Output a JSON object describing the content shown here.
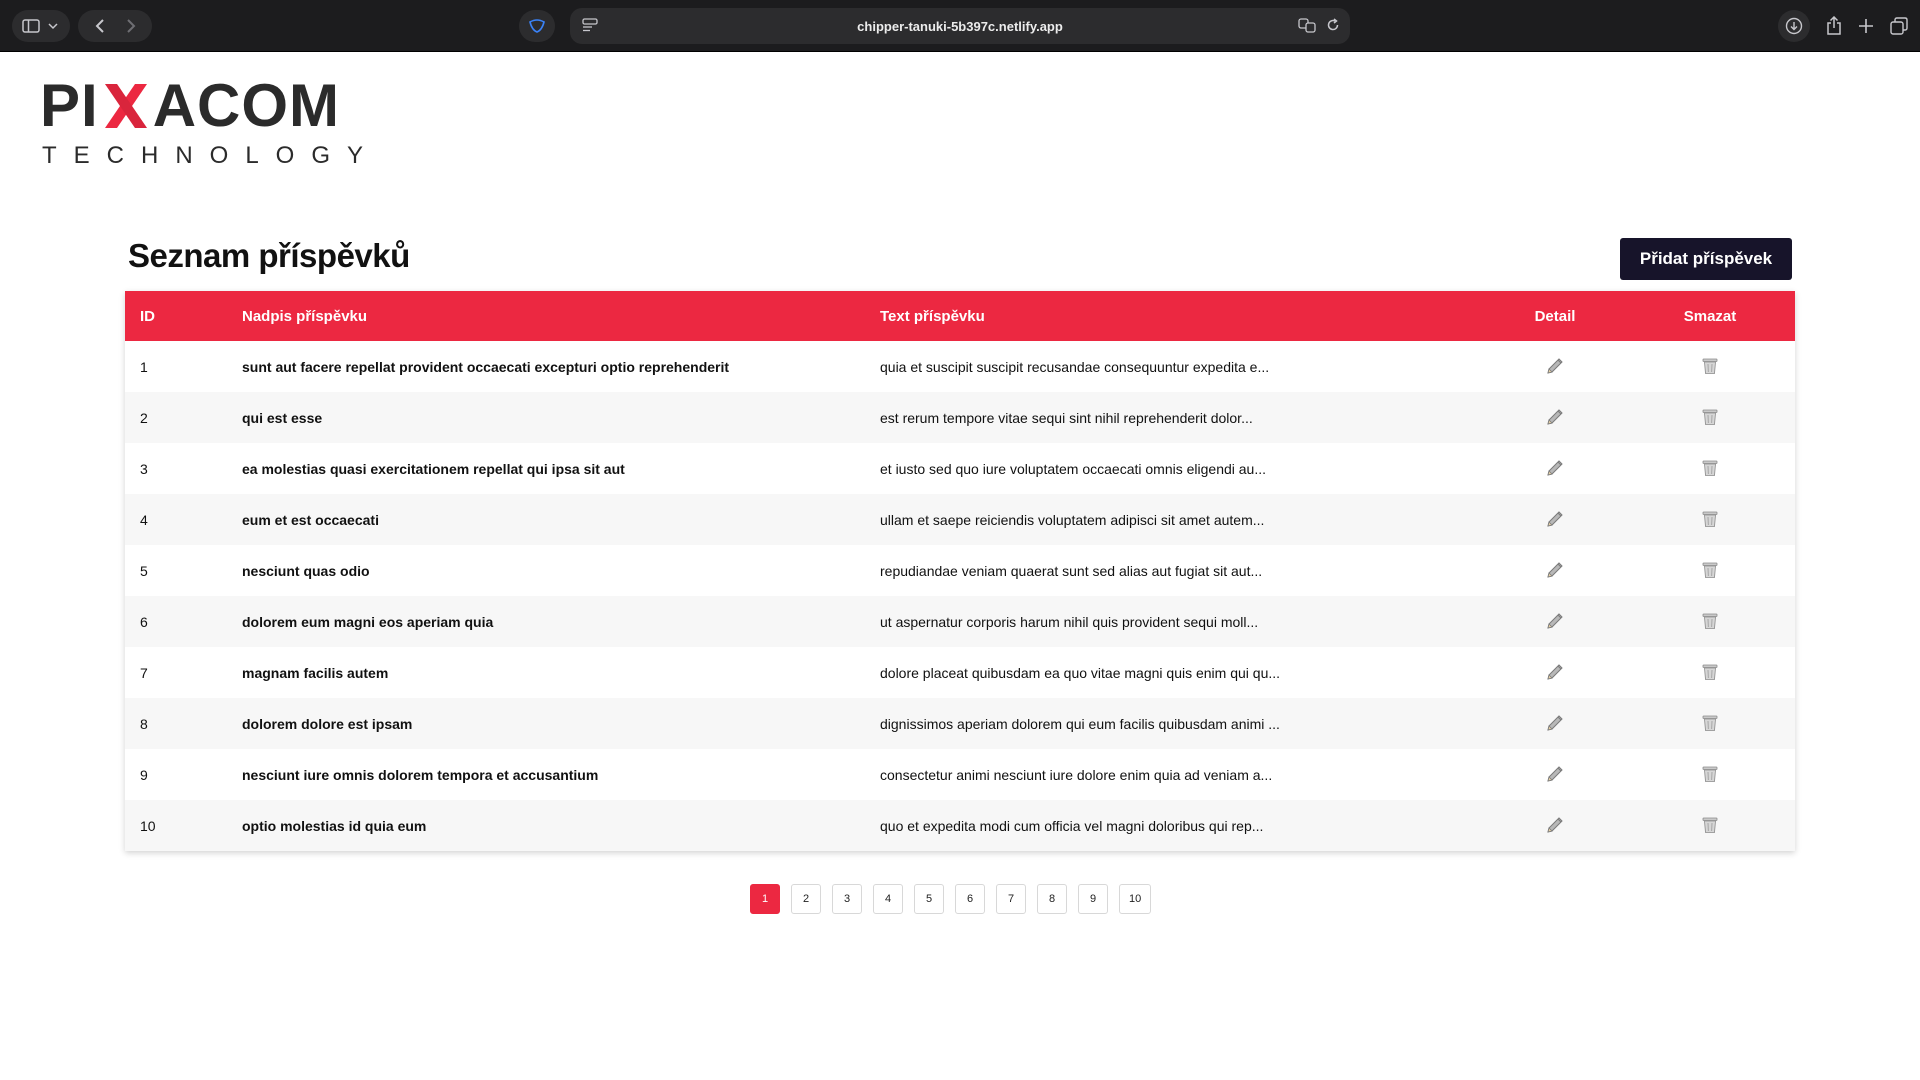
{
  "browser": {
    "url": "chipper-tanuki-5b397c.netlify.app"
  },
  "logo": {
    "brand_left": "PI",
    "brand_right": "ACOM",
    "subtitle": "TECHNOLOGY",
    "accent_color": "#ec2841"
  },
  "page": {
    "title": "Seznam příspěvků",
    "add_button": "Přidat příspěvek"
  },
  "table": {
    "headers": {
      "id": "ID",
      "title": "Nadpis příspěvku",
      "text": "Text příspěvku",
      "detail": "Detail",
      "delete": "Smazat"
    },
    "rows": [
      {
        "id": "1",
        "title": "sunt aut facere repellat provident occaecati excepturi optio reprehenderit",
        "text": "quia et suscipit suscipit recusandae consequuntur expedita e..."
      },
      {
        "id": "2",
        "title": "qui est esse",
        "text": "est rerum tempore vitae sequi sint nihil reprehenderit dolor..."
      },
      {
        "id": "3",
        "title": "ea molestias quasi exercitationem repellat qui ipsa sit aut",
        "text": "et iusto sed quo iure voluptatem occaecati omnis eligendi au..."
      },
      {
        "id": "4",
        "title": "eum et est occaecati",
        "text": "ullam et saepe reiciendis voluptatem adipisci sit amet autem..."
      },
      {
        "id": "5",
        "title": "nesciunt quas odio",
        "text": "repudiandae veniam quaerat sunt sed alias aut fugiat sit aut..."
      },
      {
        "id": "6",
        "title": "dolorem eum magni eos aperiam quia",
        "text": "ut aspernatur corporis harum nihil quis provident sequi moll..."
      },
      {
        "id": "7",
        "title": "magnam facilis autem",
        "text": "dolore placeat quibusdam ea quo vitae magni quis enim qui qu..."
      },
      {
        "id": "8",
        "title": "dolorem dolore est ipsam",
        "text": "dignissimos aperiam dolorem qui eum facilis quibusdam animi ..."
      },
      {
        "id": "9",
        "title": "nesciunt iure omnis dolorem tempora et accusantium",
        "text": "consectetur animi nesciunt iure dolore enim quia ad veniam a..."
      },
      {
        "id": "10",
        "title": "optio molestias id quia eum",
        "text": "quo et expedita modi cum officia vel magni doloribus qui rep..."
      }
    ],
    "detail_icon": "pencil-icon",
    "delete_icon": "trash-icon"
  },
  "pagination": {
    "pages": [
      "1",
      "2",
      "3",
      "4",
      "5",
      "6",
      "7",
      "8",
      "9",
      "10"
    ],
    "active_page": "1"
  }
}
